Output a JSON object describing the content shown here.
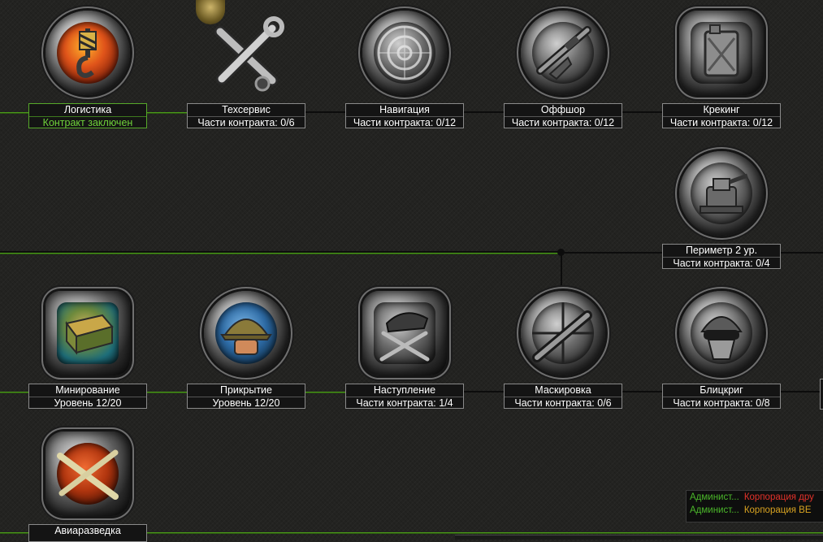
{
  "tree": {
    "row1": [
      {
        "id": "logistics",
        "title": "Логистика",
        "subtitle": "Контракт заключен",
        "completed": true,
        "icon": "crane-hook-icon"
      },
      {
        "id": "techservice",
        "title": "Техсервис",
        "subtitle": "Части контракта: 0/6",
        "completed": false,
        "icon": "wrench-screwdriver-icon"
      },
      {
        "id": "navigation",
        "title": "Навигация",
        "subtitle": "Части контракта: 0/12",
        "completed": false,
        "icon": "radar-icon"
      },
      {
        "id": "offshore",
        "title": "Оффшор",
        "subtitle": "Части контракта: 0/12",
        "completed": false,
        "icon": "rifle-icon"
      },
      {
        "id": "cracking",
        "title": "Крекинг",
        "subtitle": "Части контракта: 0/12",
        "completed": false,
        "icon": "jerrycan-icon"
      }
    ],
    "perimeter": {
      "id": "perimeter",
      "title": "Периметр 2 ур.",
      "subtitle": "Части контракта: 0/4",
      "completed": false,
      "icon": "turret-icon"
    },
    "row2": [
      {
        "id": "mining",
        "title": "Минирование",
        "subtitle": "Уровень 12/20",
        "completed": false,
        "icon": "mine-box-icon"
      },
      {
        "id": "cover",
        "title": "Прикрытие",
        "subtitle": "Уровень 12/20",
        "completed": false,
        "icon": "helmet-icon"
      },
      {
        "id": "offensive",
        "title": "Наступление",
        "subtitle": "Части контракта: 1/4",
        "completed": false,
        "icon": "beret-knives-icon"
      },
      {
        "id": "camouflage",
        "title": "Маскировка",
        "subtitle": "Части контракта: 0/6",
        "completed": false,
        "icon": "sniper-scope-icon"
      },
      {
        "id": "blitzkrieg",
        "title": "Блицкриг",
        "subtitle": "Части контракта: 0/8",
        "completed": false,
        "icon": "soldier-goggles-icon"
      }
    ],
    "recon": {
      "id": "recon",
      "title": "Авиаразведка",
      "icon": "drone-icon"
    }
  },
  "chat": [
    {
      "name": "Админист...",
      "corp": "Корпорация дру",
      "corp_color": "#e3322a"
    },
    {
      "name": "Админист...",
      "corp": "Корпорация ВЕ",
      "corp_color": "#d8a321"
    }
  ],
  "colors": {
    "accent_green": "#4b9a1a",
    "completed_text": "#6fd23a",
    "background": "#232321"
  }
}
